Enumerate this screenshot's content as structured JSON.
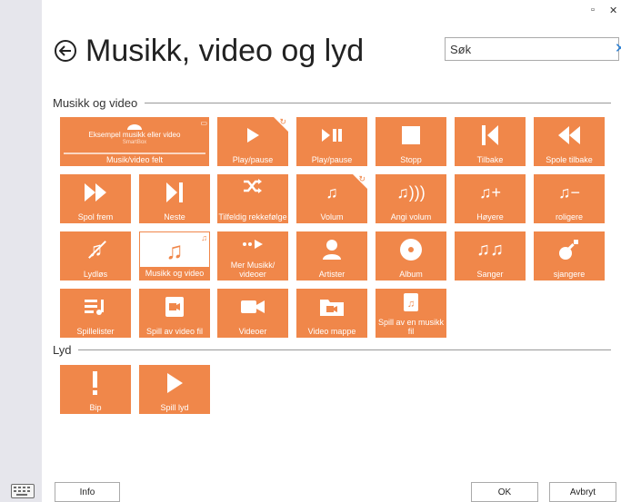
{
  "window": {
    "minimize_glyph": "▫",
    "close_glyph": "✕"
  },
  "header": {
    "title": "Musikk, video og lyd"
  },
  "search": {
    "placeholder": "Søk",
    "value": ""
  },
  "sections": {
    "music": "Musikk og video",
    "sound": "Lyd"
  },
  "tiles": {
    "music_field": {
      "preview_title": "Eksempel musikk eller video",
      "preview_sub": "SmartBox",
      "label": "Musik/video felt"
    },
    "play_pause_1": "Play/pause",
    "play_pause_2": "Play/pause",
    "stop": "Stopp",
    "back": "Tilbake",
    "rewind": "Spole tilbake",
    "fast_forward": "Spol frem",
    "next": "Neste",
    "shuffle": "Tilfeldig rekkefølge",
    "volume": "Volum",
    "set_volume": "Angi volum",
    "louder": "Høyere",
    "quieter": "roligere",
    "mute": "Lydløs",
    "music_and_video": "Musikk og video",
    "more_music": "Mer Musikk/ videoer",
    "artists": "Artister",
    "album": "Album",
    "songs": "Sanger",
    "genres": "sjangere",
    "playlists": "Spillelister",
    "play_video_file": "Spill av video fil",
    "videos": "Videoer",
    "video_folder": "Video mappe",
    "play_music_file": "Spill av en musikk fil",
    "beep": "Bip",
    "play_sound": "Spill lyd"
  },
  "footer": {
    "info": "Info",
    "ok": "OK",
    "cancel": "Avbryt"
  },
  "colors": {
    "tile": "#f0874a",
    "accent": "#2a7fd4"
  }
}
